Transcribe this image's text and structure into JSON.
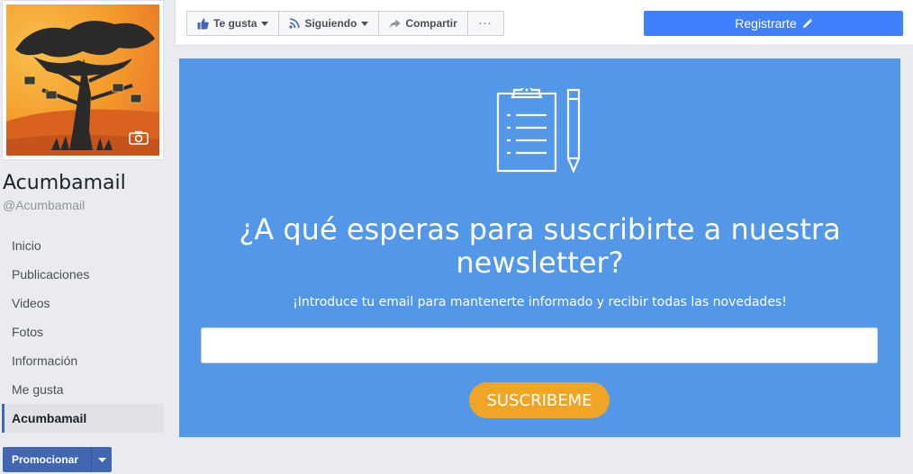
{
  "profile": {
    "name": "Acumbamail",
    "handle": "@Acumbamail"
  },
  "sidebar": {
    "items": [
      {
        "label": "Inicio"
      },
      {
        "label": "Publicaciones"
      },
      {
        "label": "Videos"
      },
      {
        "label": "Fotos"
      },
      {
        "label": "Información"
      },
      {
        "label": "Me gusta"
      },
      {
        "label": "Acumbamail",
        "active": true
      }
    ],
    "promote_label": "Promocionar"
  },
  "actions": {
    "like_label": "Te gusta",
    "follow_label": "Siguiendo",
    "share_label": "Compartir",
    "more_label": "···",
    "register_label": "Registrarte"
  },
  "newsletter": {
    "headline": "¿A qué esperas para suscribirte a nuestra newsletter?",
    "subline": "¡Introduce tu email para mantenerte informado y recibir todas las novedades!",
    "email_value": "",
    "email_placeholder": "",
    "button_label": "SUSCRIBEME"
  },
  "colors": {
    "facebook_blue": "#4267b2",
    "register_blue": "#4080ff",
    "panel_blue": "#5397e8",
    "button_orange": "#f0a526"
  },
  "icons": {
    "like": "thumbs-up-icon",
    "follow": "rss-icon",
    "share": "share-arrow-icon",
    "edit": "pencil-icon",
    "camera": "camera-icon",
    "clipboard": "clipboard-icon",
    "pencil_illustration": "pencil-icon"
  }
}
